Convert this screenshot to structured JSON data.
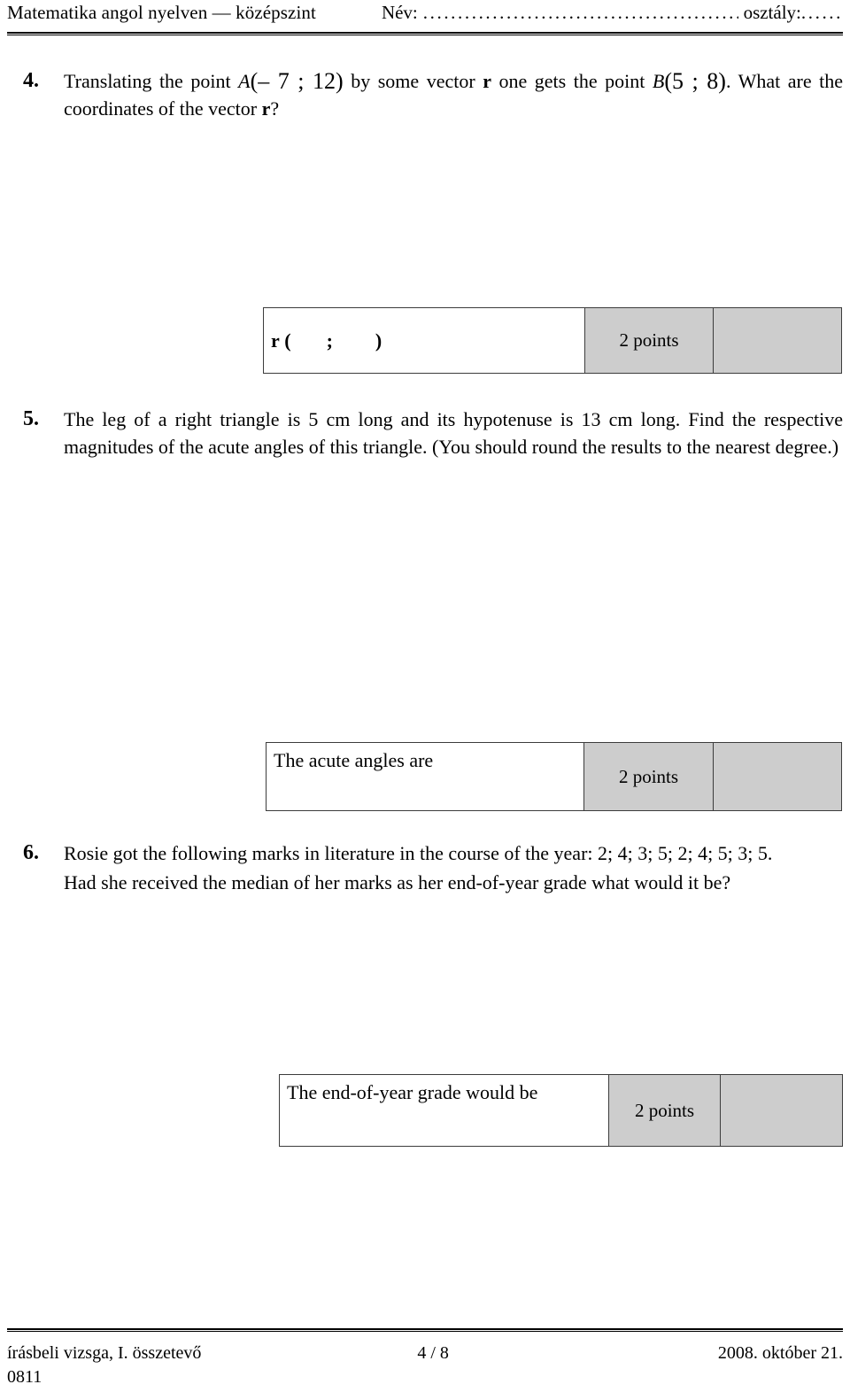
{
  "header": {
    "subject": "Matematika angol nyelven — középszint",
    "name_label": "Név:",
    "name_dots": "...................................................................",
    "class_label": "osztály:",
    "class_dots": "......"
  },
  "questions": [
    {
      "number": "4.",
      "text_part1": "Translating the point ",
      "point_a": "A",
      "point_a_coords": "(– 7 ; 12)",
      "text_part2": " by some vector ",
      "vector": "r",
      "text_part3": " one gets the point ",
      "point_b": "B",
      "point_b_coords": "(5 ; 8)",
      "text_part4": ". What are the coordinates of the vector ",
      "vector2": "r",
      "text_part5": "?",
      "answer_prefix": "r",
      "answer_open": "(",
      "answer_separator": ";",
      "answer_close": ")",
      "points_label": "2 points"
    },
    {
      "number": "5.",
      "text": "The leg of a right triangle is 5 cm long and its hypotenuse is 13 cm long. Find the respective magnitudes of the acute angles of this triangle. (You should round the results to the nearest degree.)",
      "answer_label": "The acute angles are",
      "points_label": "2 points"
    },
    {
      "number": "6.",
      "text_line1": "Rosie got the following marks in literature in the course of the year:   2; 4; 3; 5; 2; 4; 5; 3; 5.",
      "text_line2": "Had she received the median of her marks as her end-of-year grade what would it be?",
      "answer_label": "The end-of-year grade would be",
      "points_label": "2 points"
    }
  ],
  "footer": {
    "left": "írásbeli vizsga, I. összetevő",
    "code": "0811",
    "page": "4 / 8",
    "date": "2008. október 21."
  }
}
